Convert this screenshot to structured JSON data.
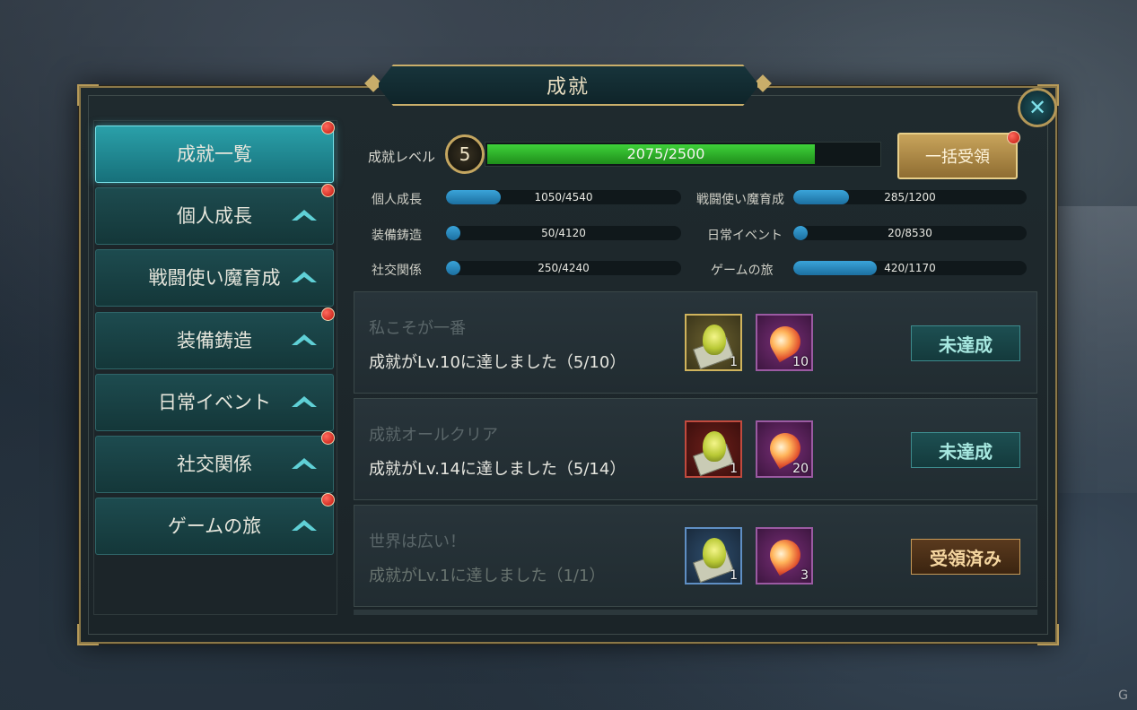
{
  "window": {
    "title": "成就",
    "close_icon": "close-icon"
  },
  "sidebar": {
    "items": [
      {
        "label": "成就一覧",
        "active": true,
        "badge": true
      },
      {
        "label": "個人成長",
        "badge": true
      },
      {
        "label": "戦闘使い魔育成",
        "badge": false
      },
      {
        "label": "装備鋳造",
        "badge": true
      },
      {
        "label": "日常イベント",
        "badge": false
      },
      {
        "label": "社交関係",
        "badge": true
      },
      {
        "label": "ゲームの旅",
        "badge": true
      }
    ]
  },
  "level": {
    "label": "成就レベル",
    "value": "5",
    "progress_text": "2075/2500",
    "progress_fraction": 0.83,
    "claim_all_label": "一括受領"
  },
  "stats": [
    {
      "label": "個人成長",
      "value": "1050/4540",
      "fraction": 0.231
    },
    {
      "label": "戦闘使い魔育成",
      "value": "285/1200",
      "fraction": 0.238
    },
    {
      "label": "装備鋳造",
      "value": "50/4120",
      "fraction": 0.012
    },
    {
      "label": "日常イベント",
      "value": "20/8530",
      "fraction": 0.002
    },
    {
      "label": "社交関係",
      "value": "250/4240",
      "fraction": 0.059
    },
    {
      "label": "ゲームの旅",
      "value": "420/1170",
      "fraction": 0.359
    }
  ],
  "achievements": [
    {
      "title": "私こそが一番",
      "desc": "成就がLv.10に達しました（5/10）",
      "rewards": [
        {
          "icon": "gold-dogtag-icon",
          "qty": "1"
        },
        {
          "icon": "flame-crest-icon",
          "qty": "10"
        }
      ],
      "status": "未達成"
    },
    {
      "title": "成就オールクリア",
      "desc": "成就がLv.14に達しました（5/14）",
      "rewards": [
        {
          "icon": "red-dogtag-icon",
          "qty": "1"
        },
        {
          "icon": "flame-crest-icon",
          "qty": "20"
        }
      ],
      "status": "未達成"
    },
    {
      "title": "世界は広い！",
      "desc": "成就がLv.1に達しました（1/1）",
      "rewards": [
        {
          "icon": "blue-dogtag-icon",
          "qty": "1"
        },
        {
          "icon": "flame-crest-icon",
          "qty": "3"
        }
      ],
      "status": "受領済み"
    }
  ],
  "watermark": "G"
}
